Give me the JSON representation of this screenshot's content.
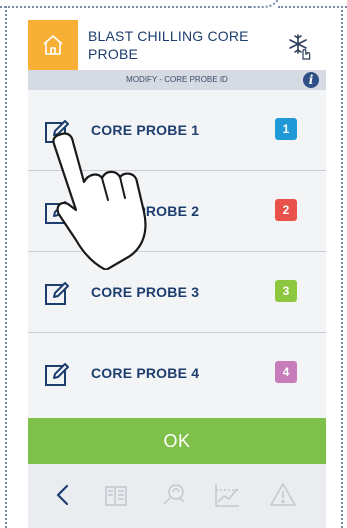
{
  "header": {
    "title": "BLAST CHILLING CORE PROBE",
    "home_icon": "home-icon",
    "mode_icon": "snowflake-hand-icon"
  },
  "subbar": {
    "text": "MODIFY - CORE PROBE ID",
    "info_label": "i"
  },
  "probes": [
    {
      "label": "CORE PROBE 1",
      "badge": "1",
      "color": "#1f9ad6"
    },
    {
      "label": "CORE PROBE 2",
      "badge": "2",
      "color": "#e8524a"
    },
    {
      "label": "CORE PROBE 3",
      "badge": "3",
      "color": "#8dc63f"
    },
    {
      "label": "CORE PROBE 4",
      "badge": "4",
      "color": "#c77dbb"
    }
  ],
  "ok_label": "OK",
  "footer": {
    "icons": [
      "back-icon",
      "recipe-book-icon",
      "settings-icon",
      "graph-icon",
      "alarm-icon"
    ]
  },
  "colors": {
    "accent": "#f7b035",
    "ok": "#7fc04a",
    "text": "#1d3e6e"
  }
}
